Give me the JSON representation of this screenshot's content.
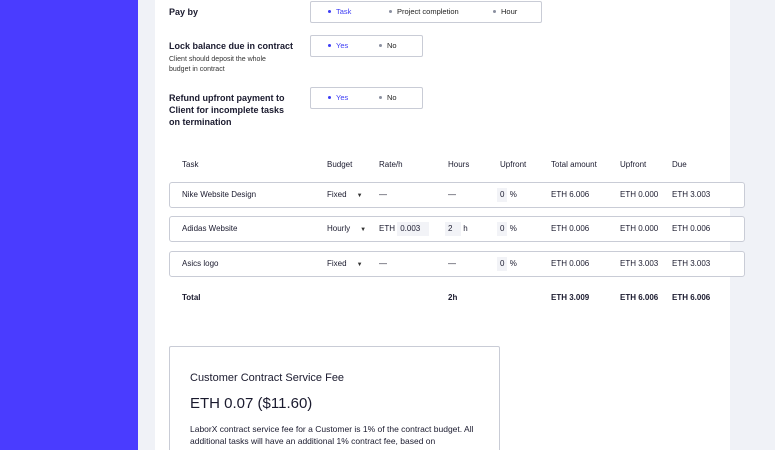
{
  "pay_by": {
    "label": "Pay by",
    "options": [
      "Task",
      "Project completion",
      "Hour"
    ],
    "selected": "Task"
  },
  "lock_balance": {
    "label": "Lock balance due in contract",
    "sublabel": "Client should deposit the whole budget in contract",
    "options": [
      "Yes",
      "No"
    ],
    "selected": "Yes"
  },
  "refund": {
    "label": "Refund upfront payment to Client for incomplete tasks on termination",
    "options": [
      "Yes",
      "No"
    ],
    "selected": "Yes"
  },
  "table": {
    "headers": {
      "task": "Task",
      "budget": "Budget",
      "rate": "Rate/h",
      "hours": "Hours",
      "upfront": "Upfront",
      "total_amount": "Total amount",
      "upfront_amount": "Upfront",
      "due": "Due"
    },
    "rows": [
      {
        "task": "Nike Website Design",
        "budget": "Fixed",
        "rate": "—",
        "hours": "—",
        "upfront": "0",
        "percent": "%",
        "total": "ETH 6.006",
        "upfront_amount": "ETH 0.000",
        "due": "ETH 3.003"
      },
      {
        "task": "Adidas Website",
        "budget": "Hourly",
        "rate_prefix": "ETH",
        "rate": "0.003",
        "hours": "2",
        "hours_unit": "h",
        "upfront": "0",
        "percent": "%",
        "total": "ETH 0.006",
        "upfront_amount": "ETH 0.000",
        "due": "ETH 0.006"
      },
      {
        "task": "Asics logo",
        "budget": "Fixed",
        "rate": "—",
        "hours": "—",
        "upfront": "0",
        "percent": "%",
        "total": "ETH 0.006",
        "upfront_amount": "ETH 3.003",
        "due": "ETH 3.003"
      }
    ],
    "totals": {
      "label": "Total",
      "hours": "2h",
      "total": "ETH 3.009",
      "upfront": "ETH 6.006",
      "due": "ETH 6.006"
    }
  },
  "fee": {
    "title": "Customer Contract Service Fee",
    "amount": "ETH 0.07 ($11.60)",
    "description": "LaborX contract service fee for a Customer is 1% of the contract budget. All additional tasks will have an additional 1% contract fee, based on"
  },
  "colors": {
    "sidebar": "#4a3cff",
    "accent": "#3d3df5",
    "background": "#f0f2f7"
  },
  "icons": {
    "select_chevron": "chevron-down-icon"
  }
}
